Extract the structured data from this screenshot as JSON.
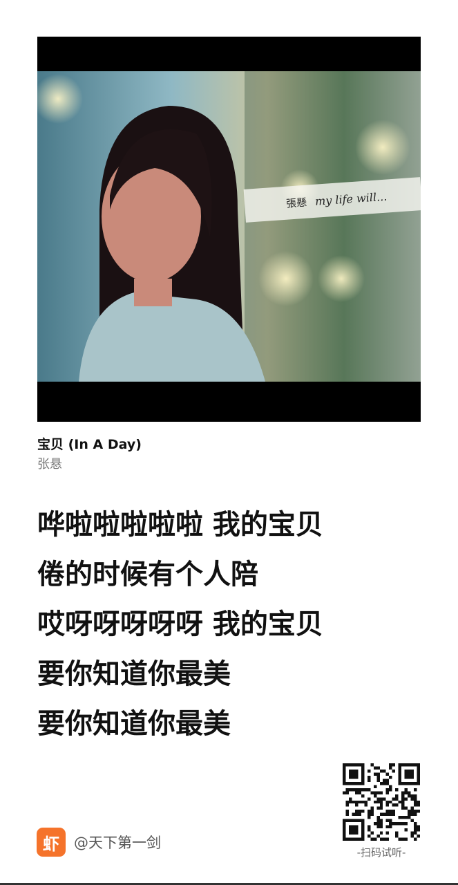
{
  "cover": {
    "image_alt": "album-cover-photo",
    "strip_name": "張懸",
    "strip_script": "my life will..."
  },
  "song": {
    "title": "宝贝 (In A Day)",
    "artist": "张悬"
  },
  "lyrics": [
    "哗啦啦啦啦啦 我的宝贝",
    "倦的时候有个人陪",
    "哎呀呀呀呀呀 我的宝贝",
    "要你知道你最美",
    "要你知道你最美"
  ],
  "footer": {
    "brand_icon_char": "虾",
    "brand_icon_name": "xiami-logo-icon",
    "brand_color": "#f5732b",
    "handle": "@天下第一剑",
    "qr_caption": "-扫码试听-"
  }
}
